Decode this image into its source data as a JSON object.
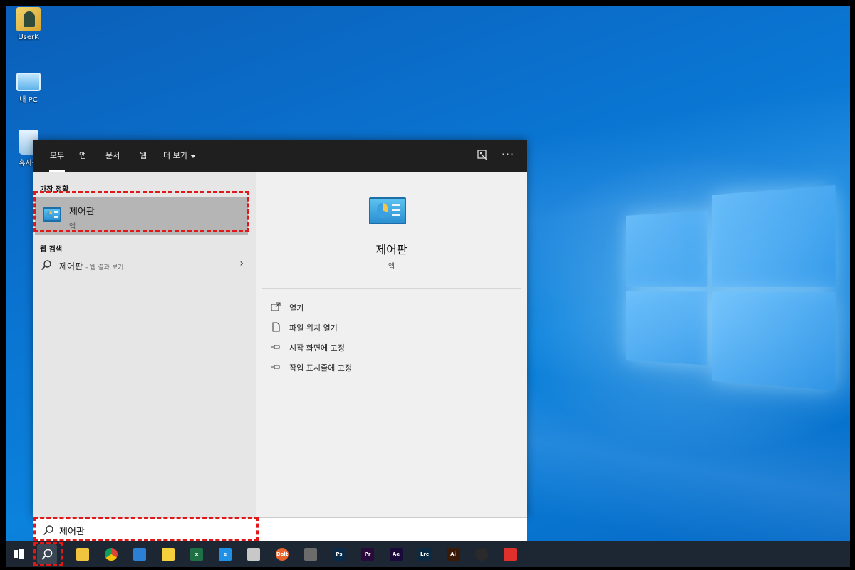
{
  "desktop": {
    "icons": [
      {
        "label": "UserK",
        "icon": "user-folder-icon"
      },
      {
        "label": "내 PC",
        "icon": "this-pc-icon"
      },
      {
        "label": "휴지통",
        "icon": "recycle-bin-icon"
      }
    ]
  },
  "search_panel": {
    "tabs": [
      {
        "label": "모두",
        "active": true
      },
      {
        "label": "앱"
      },
      {
        "label": "문서"
      },
      {
        "label": "웹"
      },
      {
        "label": "더 보기"
      }
    ],
    "header_icons": [
      "feedback-icon",
      "more-options-icon"
    ],
    "more_options_glyph": "···",
    "best_match": {
      "section_label": "가장 정확",
      "name": "제어판",
      "type": "앱",
      "icon": "control-panel-icon"
    },
    "web_search": {
      "section_label": "웹 검색",
      "query": "제어판",
      "suffix": "- 웹 결과 보기"
    },
    "detail": {
      "name": "제어판",
      "type": "앱",
      "actions": [
        {
          "label": "열기",
          "icon": "open-icon"
        },
        {
          "label": "파일 위치 열기",
          "icon": "file-location-icon"
        },
        {
          "label": "시작 화면에 고정",
          "icon": "pin-icon"
        },
        {
          "label": "작업 표시줄에 고정",
          "icon": "pin-icon"
        }
      ]
    }
  },
  "search_box": {
    "value": "제어판"
  },
  "taskbar": {
    "items": [
      {
        "name": "start-button",
        "icon": "windows-icon"
      },
      {
        "name": "search-button",
        "icon": "search-icon"
      },
      {
        "name": "file-explorer",
        "icon": "folder-icon",
        "color": "#f0c43c"
      },
      {
        "name": "chrome",
        "icon": "chrome-icon",
        "color": "#3aa757"
      },
      {
        "name": "app-blue",
        "icon": "app-icon",
        "color": "#2b7fd4"
      },
      {
        "name": "sticky-notes",
        "icon": "sticky-notes-icon",
        "color": "#f5d23c"
      },
      {
        "name": "excel",
        "icon": "excel-icon",
        "color": "#1e7145",
        "text": "x"
      },
      {
        "name": "edge",
        "icon": "edge-icon",
        "color": "#1e90e6",
        "text": "e"
      },
      {
        "name": "app-tool",
        "icon": "tool-icon",
        "color": "#c8c8c8"
      },
      {
        "name": "app-orange",
        "icon": "orange-app-icon",
        "color": "#e8622c",
        "text": "Dolt"
      },
      {
        "name": "calculator",
        "icon": "calculator-icon",
        "color": "#6b6b6b"
      },
      {
        "name": "photoshop",
        "icon": "photoshop-icon",
        "color": "#0a2a4a",
        "text": "Ps"
      },
      {
        "name": "premiere",
        "icon": "premiere-icon",
        "color": "#2a0a3a",
        "text": "Pr"
      },
      {
        "name": "after-effects",
        "icon": "after-effects-icon",
        "color": "#1a0a3a",
        "text": "Ae"
      },
      {
        "name": "lightroom-classic",
        "icon": "lightroom-icon",
        "color": "#0a2a44",
        "text": "Lrc"
      },
      {
        "name": "illustrator",
        "icon": "illustrator-icon",
        "color": "#3a1a06",
        "text": "Ai"
      },
      {
        "name": "obs",
        "icon": "obs-icon",
        "color": "#2a2a2a"
      },
      {
        "name": "app-red",
        "icon": "red-app-icon",
        "color": "#e0302c"
      }
    ]
  },
  "annotation_color": "#e01818"
}
